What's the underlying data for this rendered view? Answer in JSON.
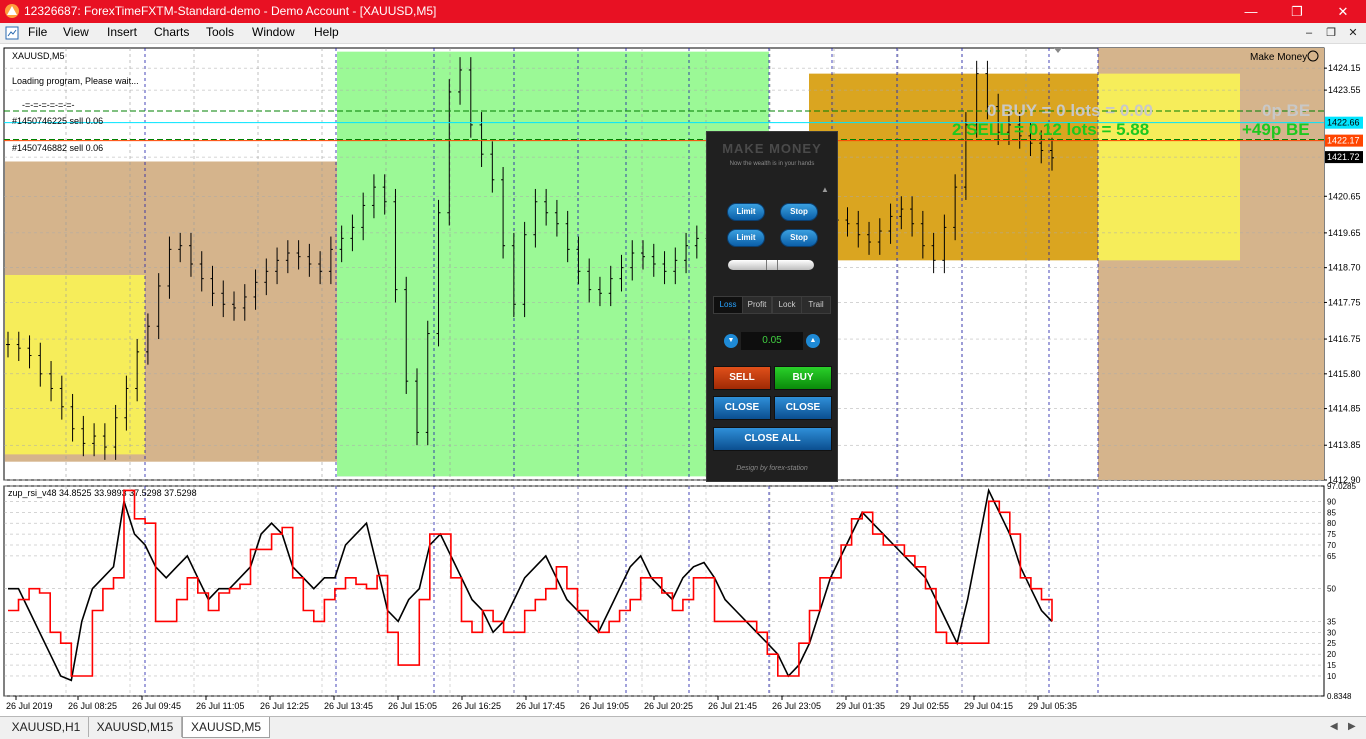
{
  "window": {
    "title": "12326687: ForexTimeFXTM-Standard-demo - Demo Account - [XAUUSD,M5]",
    "minimize_icon": "minimize-icon",
    "maximize_icon": "restore-icon",
    "close_icon": "close-icon"
  },
  "menu": {
    "items": [
      "File",
      "View",
      "Insert",
      "Charts",
      "Tools",
      "Window",
      "Help"
    ]
  },
  "chart": {
    "symbol": "XAUUSD,M5",
    "loading_text": "Loading program, Please wait...",
    "dashes": "-=-=-=-=-=-=-",
    "order_1": "#1450746225 sell 0.06",
    "order_2": "#1450746882 sell 0.06",
    "ea_name": "Make Money",
    "buy_stats": "0 BUY = 0 lots = 0.00",
    "buy_be": "0p BE",
    "sell_stats": "2 SELL = 0.12 lots = 5.88",
    "sell_be": "+49p BE",
    "price_labels": [
      "1424.15",
      "1423.55",
      "1422.66",
      "1422.17",
      "1421.72",
      "1420.65",
      "1419.65",
      "1418.70",
      "1417.75",
      "1416.75",
      "1415.80",
      "1414.85",
      "1413.85",
      "1412.90"
    ],
    "indicator_label": "zup_rsi_v48 34.8525 33.9893 37.5298 37.5298",
    "indicator_levels": [
      "97.0285",
      "90",
      "85",
      "80",
      "75",
      "70",
      "65",
      "50",
      "35",
      "30",
      "25",
      "20",
      "15",
      "10",
      "0.8348"
    ],
    "time_labels": [
      "26 Jul 2019",
      "26 Jul 08:25",
      "26 Jul 09:45",
      "26 Jul 11:05",
      "26 Jul 12:25",
      "26 Jul 13:45",
      "26 Jul 15:05",
      "26 Jul 16:25",
      "26 Jul 17:45",
      "26 Jul 19:05",
      "26 Jul 20:25",
      "26 Jul 21:45",
      "26 Jul 23:05",
      "29 Jul 01:35",
      "29 Jul 02:55",
      "29 Jul 04:15",
      "29 Jul 05:35"
    ],
    "colors": {
      "tan": "#d5b48c",
      "yellow": "#f6ed5a",
      "lavender": "#aca6ee",
      "green": "#9bf996",
      "orange": "#daa520",
      "buy_text": "#c8c8c8",
      "sell_text": "#1ec81e",
      "rsi_red": "#ff0000"
    }
  },
  "panel": {
    "title": "MAKE MONEY",
    "subtitle": "Now the wealth is in your hands",
    "limit_1": "Limit",
    "stop_1": "Stop",
    "limit_2": "Limit",
    "stop_2": "Stop",
    "tabs": [
      "Loss",
      "Profit",
      "Lock",
      "Trail"
    ],
    "step_value": "0.05",
    "sell": "SELL",
    "buy": "BUY",
    "close_sell": "CLOSE",
    "close_buy": "CLOSE",
    "close_all": "CLOSE ALL",
    "design": "Design by forex-station"
  },
  "tabs": {
    "items": [
      "XAUUSD,H1",
      "XAUUSD,M15",
      "XAUUSD,M5"
    ],
    "active": "XAUUSD,M5"
  },
  "chart_data": {
    "type": "line",
    "title": "XAUUSD,M5",
    "main_chart": {
      "kind": "bar",
      "ylim": [
        1412.9,
        1424.7
      ],
      "close_prices": [
        1416.6,
        1416.5,
        1416.3,
        1415.8,
        1415.4,
        1414.9,
        1414.3,
        1413.9,
        1414.1,
        1413.8,
        1414.6,
        1415.4,
        1416.4,
        1417.1,
        1418.2,
        1419.2,
        1419.3,
        1418.8,
        1418.4,
        1418.0,
        1417.7,
        1417.6,
        1417.9,
        1418.3,
        1418.6,
        1418.9,
        1419.1,
        1419.0,
        1418.8,
        1418.6,
        1419.2,
        1419.5,
        1419.8,
        1420.4,
        1420.9,
        1420.5,
        1418.1,
        1415.6,
        1414.2,
        1416.9,
        1420.2,
        1423.5,
        1424.1,
        1422.6,
        1421.8,
        1421.1,
        1419.3,
        1417.7,
        1419.6,
        1420.5,
        1420.2,
        1419.9,
        1419.2,
        1418.6,
        1418.1,
        1418.0,
        1418.4,
        1418.7,
        1419.1,
        1419.0,
        1418.8,
        1418.6,
        1418.9,
        1419.3,
        1419.5,
        1419.7,
        1419.4,
        1419.2,
        1419.5,
        1419.8,
        1419.9,
        1419.7,
        1419.5,
        1419.6,
        1419.4,
        1419.6,
        1419.8,
        1420.0,
        1419.9,
        1419.6,
        1419.4,
        1419.7,
        1420.1,
        1420.3,
        1419.9,
        1419.3,
        1418.9,
        1419.8,
        1420.9,
        1422.6,
        1424.0,
        1423.1,
        1422.4,
        1422.6,
        1422.3,
        1422.1,
        1421.9,
        1421.7
      ],
      "rectangles": [
        {
          "color": "tan",
          "price_top": 1421.6,
          "price_bottom": 1413.4
        },
        {
          "color": "yellow",
          "price_top": 1418.5,
          "price_bottom": 1413.6
        },
        {
          "color": "lavender",
          "price_top": 1421.6,
          "price_bottom": 1413.0
        },
        {
          "color": "green",
          "price_top": 1424.6,
          "price_bottom": 1413.0
        },
        {
          "color": "orange",
          "price_top": 1424.0,
          "price_bottom": 1418.9
        },
        {
          "color": "yellow",
          "price_top": 1424.0,
          "price_bottom": 1418.9
        }
      ],
      "lines": [
        {
          "label": "#1450746225 sell 0.06",
          "price": 1422.98,
          "style": "dashed",
          "color": "#008000"
        },
        {
          "label": "#1450746882 sell 0.06",
          "price": 1422.2,
          "style": "dashed",
          "color": "#008000"
        },
        {
          "label": "",
          "price": 1422.66,
          "style": "solid",
          "color": "#00e5ff"
        },
        {
          "label": "",
          "price": 1422.17,
          "style": "solid",
          "color": "#ff4500"
        }
      ]
    },
    "indicator": {
      "name": "zup_rsi_v48",
      "ylim": [
        0.8348,
        97.0285
      ],
      "series": [
        {
          "values": [
            50,
            50,
            40,
            30,
            20,
            10,
            8,
            35,
            50,
            55,
            60,
            90,
            75,
            70,
            60,
            55,
            60,
            65,
            55,
            45,
            50,
            50,
            55,
            60,
            75,
            80,
            75,
            60,
            55,
            50,
            55,
            55,
            70,
            75,
            80,
            60,
            40,
            35,
            45,
            50,
            70,
            75,
            65,
            55,
            45,
            40,
            30,
            35,
            45,
            55,
            60,
            65,
            55,
            45,
            40,
            35,
            30,
            40,
            50,
            60,
            65,
            55,
            50,
            45,
            55,
            60,
            62,
            55,
            45,
            40,
            35,
            30,
            25,
            20,
            10,
            15,
            25,
            40,
            55,
            65,
            75,
            85,
            80,
            75,
            70,
            65,
            60,
            55,
            45,
            35,
            25,
            45,
            70,
            95,
            85,
            75,
            60,
            50,
            40,
            35
          ]
        },
        {
          "values": [
            40,
            45,
            50,
            48,
            30,
            25,
            10,
            10,
            40,
            50,
            55,
            95,
            82,
            80,
            35,
            35,
            45,
            55,
            48,
            40,
            48,
            50,
            52,
            68,
            68,
            75,
            78,
            55,
            40,
            35,
            45,
            50,
            55,
            52,
            50,
            56,
            30,
            15,
            15,
            45,
            75,
            75,
            55,
            35,
            30,
            40,
            35,
            30,
            30,
            40,
            45,
            50,
            60,
            50,
            40,
            35,
            30,
            35,
            40,
            45,
            55,
            55,
            48,
            40,
            45,
            55,
            55,
            35,
            35,
            35,
            35,
            30,
            20,
            10,
            10,
            25,
            40,
            55,
            55,
            70,
            82,
            85,
            75,
            70,
            70,
            65,
            60,
            50,
            30,
            25,
            25,
            25,
            25,
            90,
            85,
            75,
            55,
            50,
            45,
            35
          ]
        }
      ]
    },
    "xlabel": "",
    "ylabel": ""
  }
}
